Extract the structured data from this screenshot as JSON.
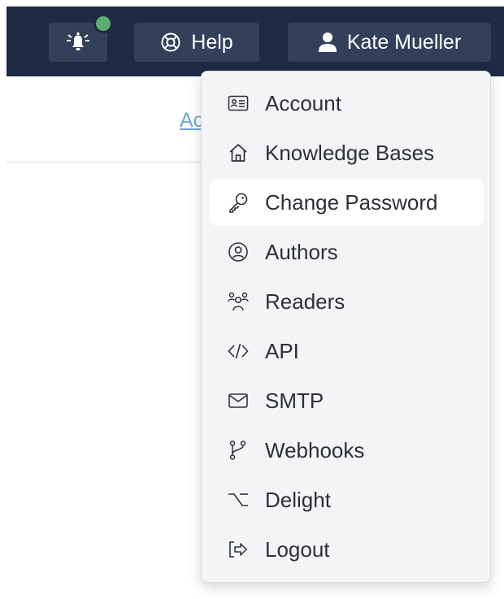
{
  "topbar": {
    "notifications_icon": "bell-icon",
    "help_label": "Help",
    "user_name": "Kate Mueller",
    "indicator_color": "#5eac72",
    "bar_color": "#1f2a44"
  },
  "page": {
    "tab_partial": "Ac"
  },
  "menu": {
    "items": [
      {
        "label": "Account",
        "icon": "id-card-icon"
      },
      {
        "label": "Knowledge Bases",
        "icon": "home-icon"
      },
      {
        "label": "Change Password",
        "icon": "key-icon",
        "active": true
      },
      {
        "label": "Authors",
        "icon": "user-circle-icon"
      },
      {
        "label": "Readers",
        "icon": "users-group-icon"
      },
      {
        "label": "API",
        "icon": "code-icon"
      },
      {
        "label": "SMTP",
        "icon": "envelope-icon"
      },
      {
        "label": "Webhooks",
        "icon": "git-branch-icon"
      },
      {
        "label": "Delight",
        "icon": "option-key-icon"
      },
      {
        "label": "Logout",
        "icon": "logout-icon"
      }
    ]
  }
}
